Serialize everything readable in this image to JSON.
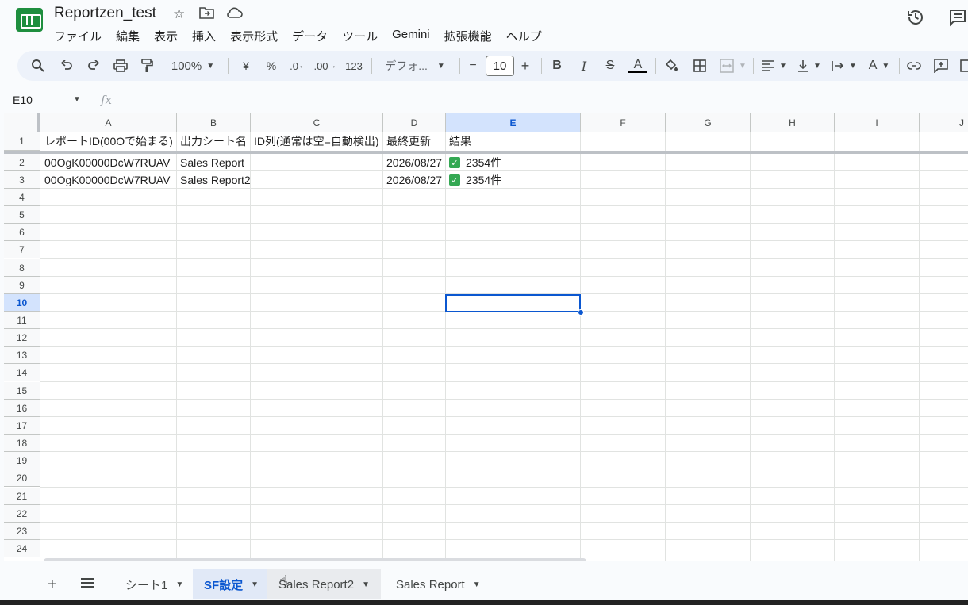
{
  "app": {
    "doc_title": "Reportzen_test",
    "menu": [
      "ファイル",
      "編集",
      "表示",
      "挿入",
      "表示形式",
      "データ",
      "ツール",
      "Gemini",
      "拡張機能",
      "ヘルプ"
    ]
  },
  "toolbar": {
    "zoom": "100%",
    "currency": "¥",
    "percent": "%",
    "decimal_decrease": ".0",
    "decimal_increase": ".00",
    "number_format": "123",
    "font": "デフォ...",
    "font_size_minus": "−",
    "font_size": "10",
    "font_size_plus": "+",
    "bold": "B",
    "italic": "I",
    "strikethrough": "S",
    "text_color": "A",
    "text_rotation": "A"
  },
  "formula_bar": {
    "name_box": "E10",
    "fx": "fx"
  },
  "grid": {
    "columns": [
      "A",
      "B",
      "C",
      "D",
      "E",
      "F",
      "G",
      "H",
      "I",
      "J"
    ],
    "selected_column": "E",
    "rows": [
      "1",
      "2",
      "3",
      "4",
      "5",
      "6",
      "7",
      "8",
      "9",
      "10",
      "11",
      "12",
      "13",
      "14",
      "15",
      "16",
      "17",
      "18",
      "19",
      "20",
      "21",
      "22",
      "23",
      "24"
    ],
    "selected_row": "10",
    "header_row": {
      "A": "レポートID(00Oで始まる)",
      "B": "出力シート名",
      "C": "ID列(通常は空=自動検出)",
      "D": "最終更新",
      "E": "結果"
    },
    "data_rows": [
      {
        "A": "00OgK00000DcW7RUAV",
        "B": "Sales Report",
        "C": "",
        "D": "2026/08/27",
        "E": "2354件"
      },
      {
        "A": "00OgK00000DcW7RUAV",
        "B": "Sales Report2",
        "C": "",
        "D": "2026/08/27",
        "E": "2354件"
      }
    ]
  },
  "sheet_tabs": [
    {
      "label": "シート1",
      "active": false
    },
    {
      "label": "SF設定",
      "active": true
    },
    {
      "label": "Sales Report2",
      "active": false
    },
    {
      "label": "Sales Report",
      "active": false
    }
  ],
  "colors": {
    "accent": "#0b57d0",
    "selected_header_bg": "#d3e3fd",
    "toolbar_bg": "#edf2fa",
    "check_green": "#34a853",
    "logo_green": "#1e8e3e"
  }
}
